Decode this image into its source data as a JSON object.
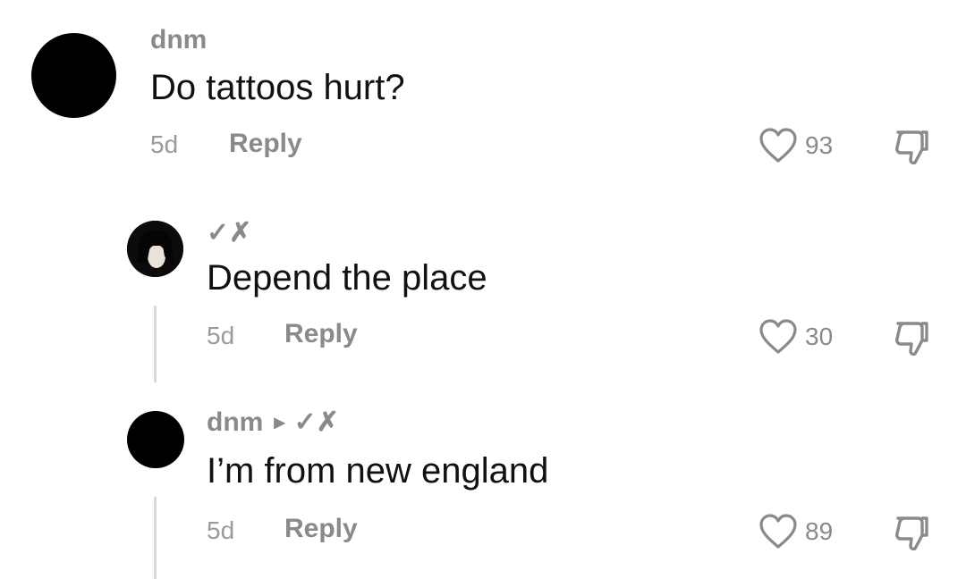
{
  "comments": [
    {
      "username": "dnm",
      "text": "Do tattoos hurt?",
      "time": "5d",
      "reply_label": "Reply",
      "likes": "93"
    },
    {
      "username": "✓✗",
      "text": "Depend the place",
      "time": "5d",
      "reply_label": "Reply",
      "likes": "30"
    },
    {
      "username": "dnm",
      "reply_to": "✓✗",
      "text": "I’m from new england",
      "time": "5d",
      "reply_label": "Reply",
      "likes": "89"
    }
  ],
  "icons": {
    "like": "heart-outline-icon",
    "dislike": "thumbs-down-icon",
    "reply_arrow": "triangle-right-icon"
  },
  "colors": {
    "muted": "#8a8a8a",
    "text": "#111111",
    "thread_line": "#d9d9d9"
  }
}
